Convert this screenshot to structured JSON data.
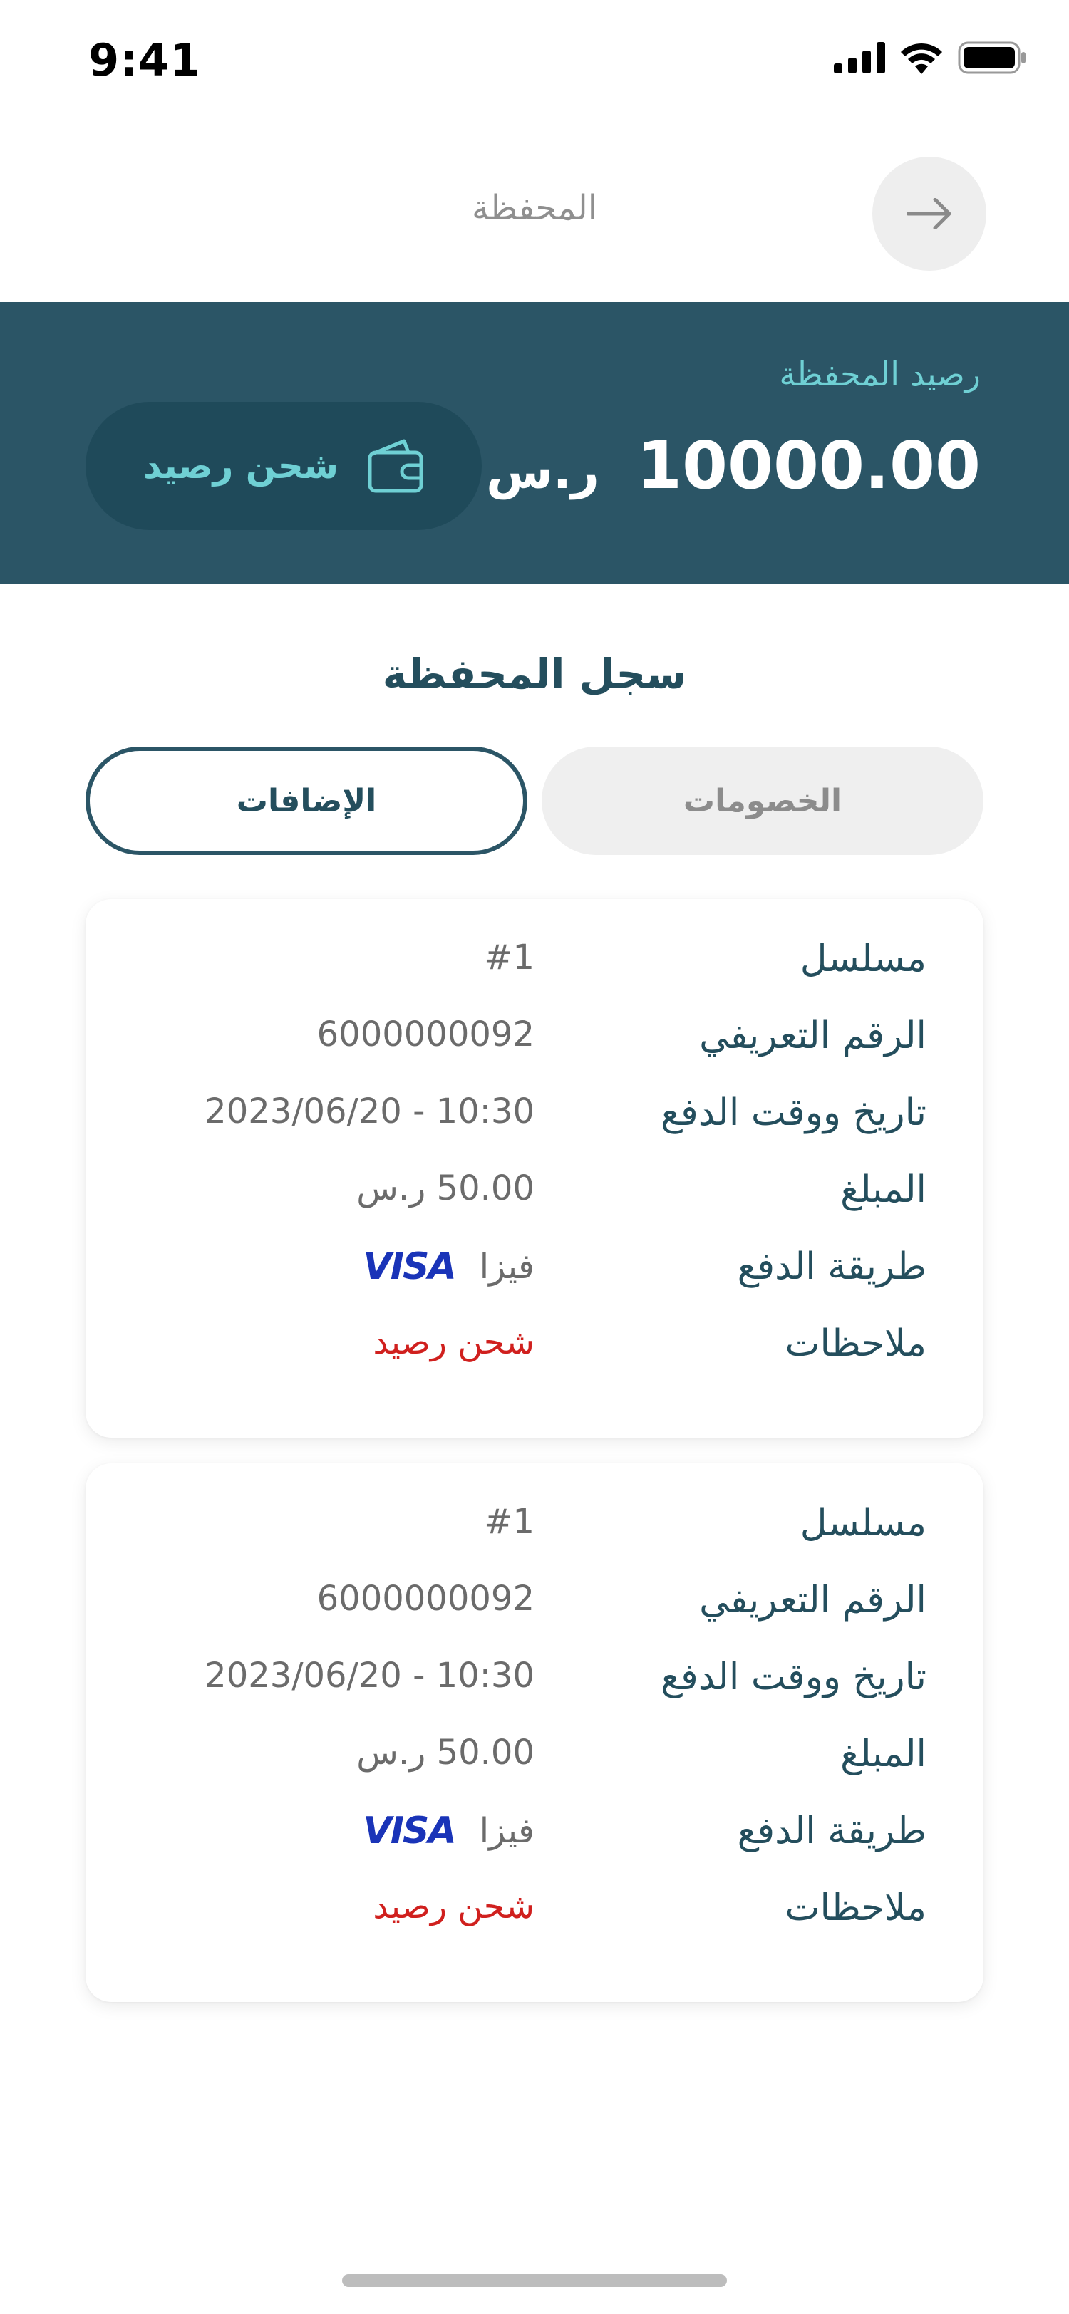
{
  "status_bar": {
    "time": "9:41"
  },
  "nav": {
    "title": "المحفظة"
  },
  "balance": {
    "label": "رصيد المحفظة",
    "amount": "10000.00",
    "currency": "ر.س",
    "topup_label": "شحن رصيد"
  },
  "history": {
    "title": "سجل المحفظة",
    "tabs": {
      "deductions": "الخصومات",
      "additions": "الإضافات",
      "active": "additions"
    }
  },
  "fields": {
    "serial": "مسلسل",
    "id": "الرقم التعريفي",
    "datetime": "تاريخ ووقت الدفع",
    "amount": "المبلغ",
    "method": "طريقة الدفع",
    "notes": "ملاحظات"
  },
  "transactions": [
    {
      "serial": "#1",
      "id": "6000000092",
      "datetime": "2023/06/20 - 10:30",
      "amount": "50.00 ر.س",
      "method": "فيزا",
      "method_logo": "VISA",
      "notes": "شحن رصيد"
    },
    {
      "serial": "#1",
      "id": "6000000092",
      "datetime": "2023/06/20 - 10:30",
      "amount": "50.00 ر.س",
      "method": "فيزا",
      "method_logo": "VISA",
      "notes": "شحن رصيد"
    }
  ],
  "colors": {
    "banner": "#2b5566",
    "accent": "#6fd0d4",
    "heading": "#244e5d",
    "note": "#d0201e",
    "visa": "#1a34b8"
  }
}
